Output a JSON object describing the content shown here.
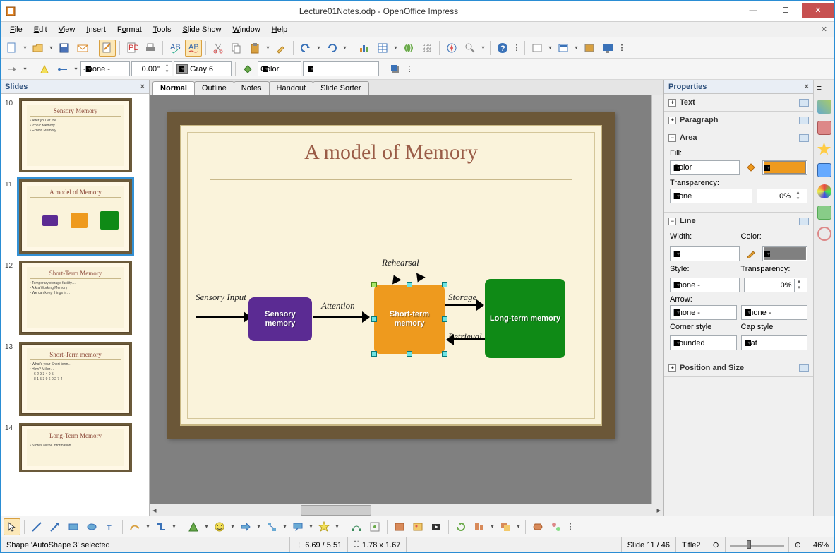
{
  "window": {
    "title": "Lecture01Notes.odp - OpenOffice Impress"
  },
  "menu": [
    "File",
    "Edit",
    "View",
    "Insert",
    "Format",
    "Tools",
    "Slide Show",
    "Window",
    "Help"
  ],
  "toolbar2": {
    "line_style": "- none -",
    "line_width": "0.00\"",
    "line_color_label": "Gray 6",
    "area_type": "Color"
  },
  "slides_panel": {
    "title": "Slides",
    "items": [
      {
        "num": "10",
        "title": "Sensory Memory"
      },
      {
        "num": "11",
        "title": "A model of Memory"
      },
      {
        "num": "12",
        "title": "Short-Term Memory"
      },
      {
        "num": "13",
        "title": "Short-Term memory"
      },
      {
        "num": "14",
        "title": "Long-Term Memory"
      }
    ]
  },
  "view_tabs": [
    "Normal",
    "Outline",
    "Notes",
    "Handout",
    "Slide Sorter"
  ],
  "slide": {
    "title": "A model of Memory",
    "labels": {
      "sensory_input": "Sensory Input",
      "attention": "Attention",
      "rehearsal": "Rehearsal",
      "storage": "Storage",
      "retrieval": "Retrieval"
    },
    "boxes": {
      "sensory": "Sensory memory",
      "short": "Short-term memory",
      "long": "Long-term memory"
    }
  },
  "properties": {
    "title": "Properties",
    "sections": {
      "text": "Text",
      "paragraph": "Paragraph",
      "area": "Area",
      "line": "Line",
      "position": "Position and Size"
    },
    "area": {
      "fill_label": "Fill:",
      "fill_type": "Color",
      "transparency_label": "Transparency:",
      "transparency_type": "None",
      "transparency_value": "0%"
    },
    "line": {
      "width_label": "Width:",
      "color_label": "Color:",
      "style_label": "Style:",
      "style_value": "- none -",
      "transparency_label": "Transparency:",
      "transparency_value": "0%",
      "arrow_label": "Arrow:",
      "arrow_start": "- none -",
      "arrow_end": "- none -",
      "corner_label": "Corner style",
      "corner_value": "Rounded",
      "cap_label": "Cap style",
      "cap_value": "Flat"
    }
  },
  "status": {
    "selection": "Shape 'AutoShape 3' selected",
    "pos": "6.69 / 5.51",
    "size": "1.78 x 1.67",
    "slide": "Slide 11 / 46",
    "template": "Title2",
    "zoom": "46%"
  }
}
